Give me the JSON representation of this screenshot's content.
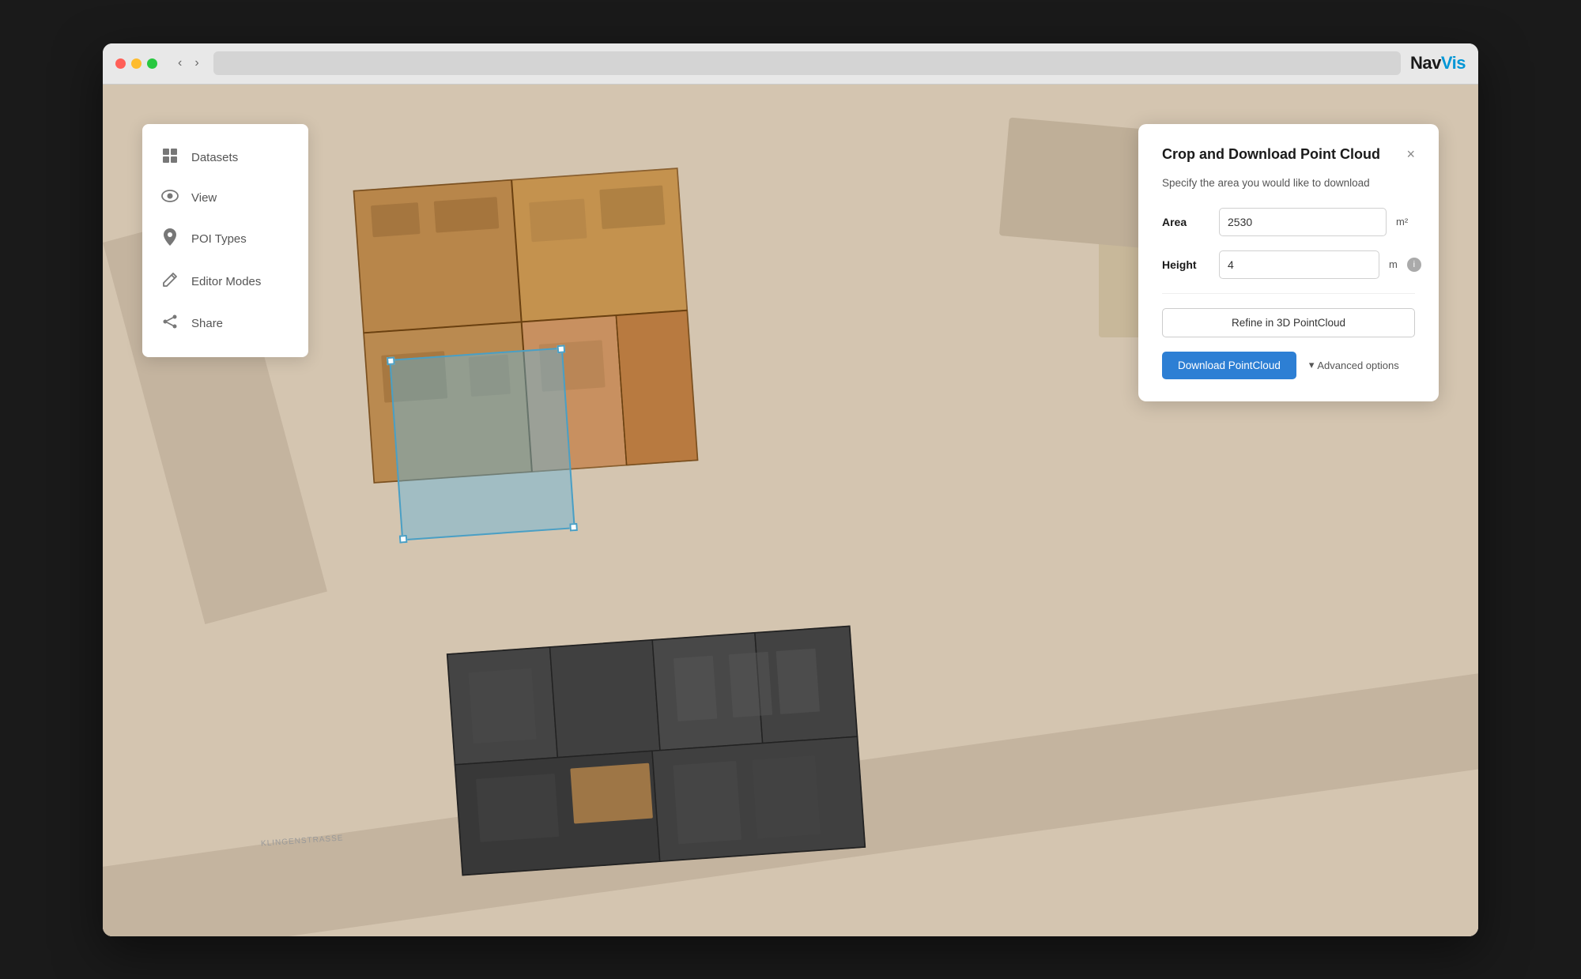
{
  "browser": {
    "traffic_lights": [
      "red",
      "yellow",
      "green"
    ],
    "nav_back": "‹",
    "nav_forward": "›"
  },
  "logo": {
    "nav_part": "Nav",
    "vis_part": "Vis"
  },
  "sidebar": {
    "items": [
      {
        "id": "datasets",
        "label": "Datasets",
        "icon": "grid"
      },
      {
        "id": "view",
        "label": "View",
        "icon": "eye"
      },
      {
        "id": "poi-types",
        "label": "POI Types",
        "icon": "location"
      },
      {
        "id": "editor-modes",
        "label": "Editor Modes",
        "icon": "pencil"
      },
      {
        "id": "share",
        "label": "Share",
        "icon": "share"
      }
    ]
  },
  "crop_panel": {
    "title": "Crop and Download Point Cloud",
    "close_label": "×",
    "subtitle": "Specify the area you would like to download",
    "area_label": "Area",
    "area_value": "2530",
    "area_unit": "m²",
    "height_label": "Height",
    "height_value": "4",
    "height_unit": "m",
    "refine_button_label": "Refine in 3D PointCloud",
    "download_button_label": "Download PointCloud",
    "advanced_options_chevron": "▾",
    "advanced_options_label": "Advanced options"
  },
  "map": {
    "street_label": "KLINGENSTRASSE"
  }
}
